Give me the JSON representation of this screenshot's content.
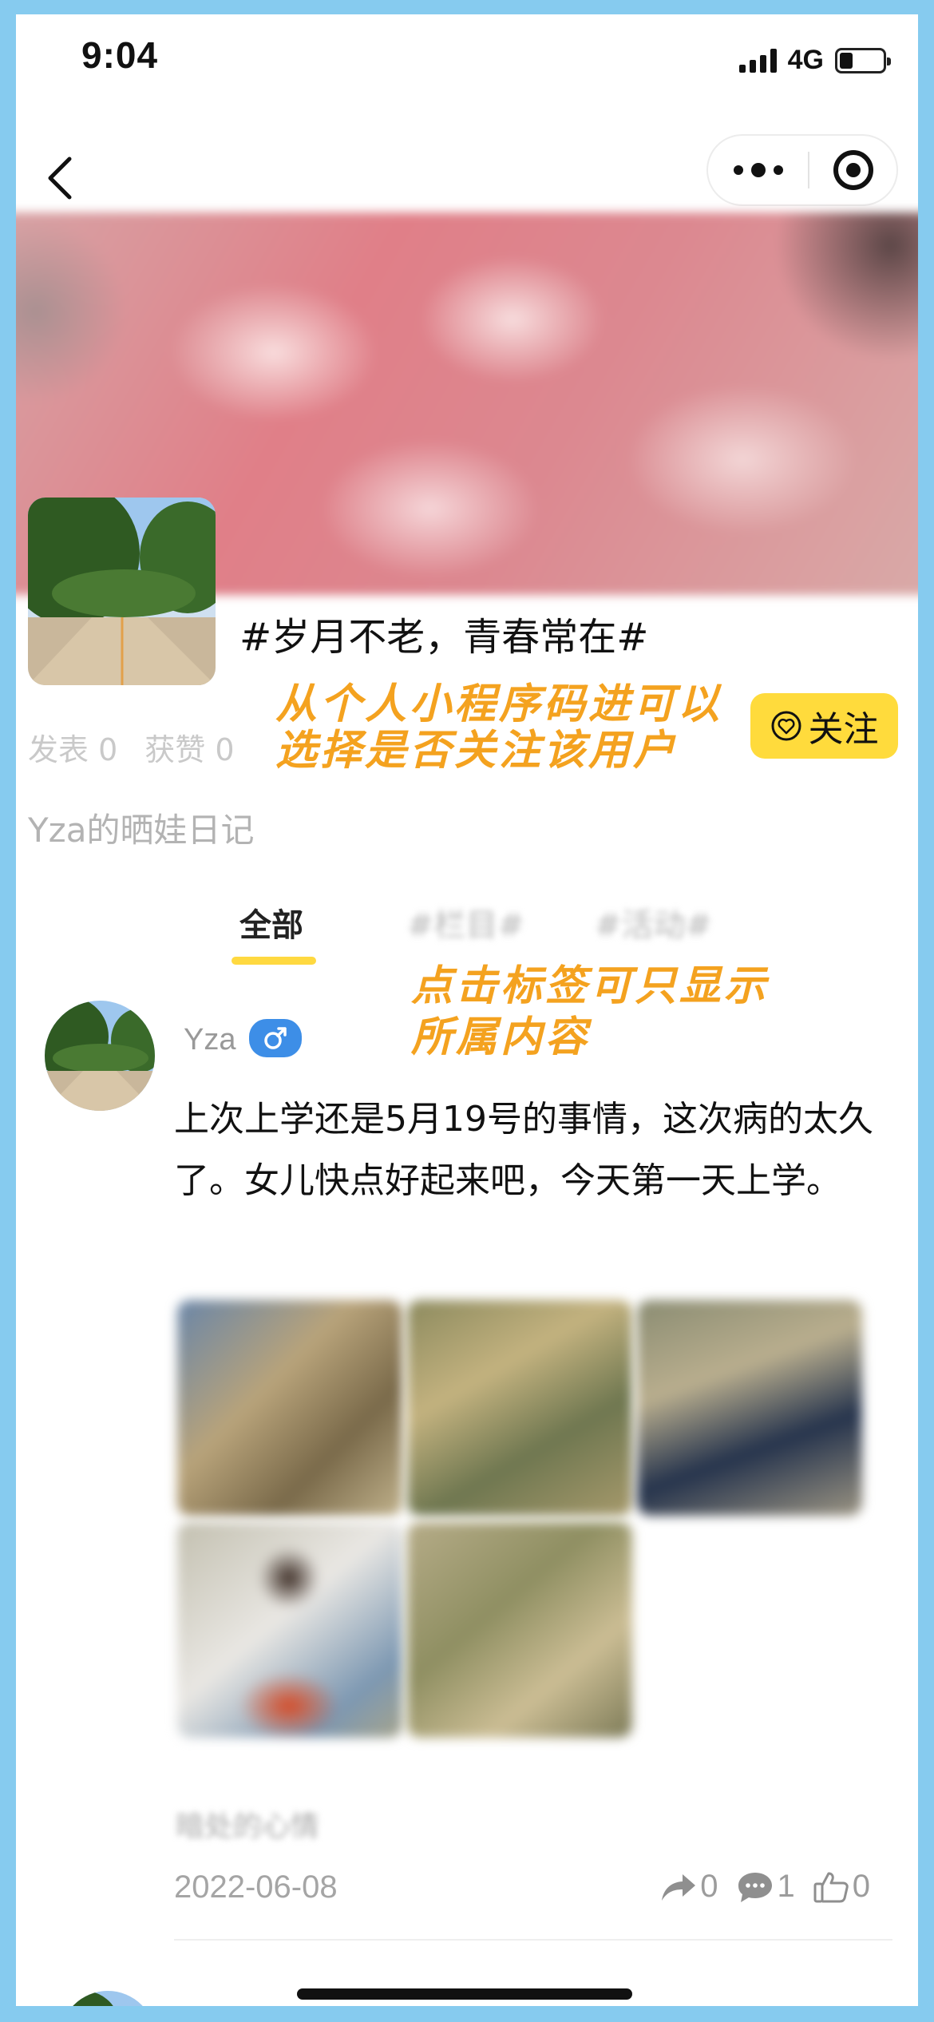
{
  "status_bar": {
    "time": "9:04",
    "network": "4G"
  },
  "profile": {
    "tag_title": "#岁月不老，青春常在#",
    "stats": {
      "posts_label": "发表 0",
      "likes_label": "获赞 0"
    },
    "diary_title": "Yza的晒娃日记",
    "follow_label": "关注"
  },
  "annotations": {
    "follow_note": "从个人小程序码进可以选择是否关注该用户",
    "tag_note": "点击标签可只显示所属内容"
  },
  "tabs": [
    {
      "label": "全部",
      "active": true
    },
    {
      "label": "#栏目#",
      "active": false
    },
    {
      "label": "#活动#",
      "active": false
    }
  ],
  "post": {
    "username": "Yza",
    "gender": "♂",
    "text": "上次上学还是5月19号的事情，这次病的太久了。女儿快点好起来吧，今天第一天上学。",
    "blurred_caption": "暗处的心情",
    "date": "2022-06-08",
    "share_count": "0",
    "comment_count": "1",
    "like_count": "0"
  },
  "colors": {
    "accent_yellow": "#ffdb3c",
    "annotation_orange": "#f4a21f",
    "gender_blue": "#3d8ee7",
    "frame_blue": "#86cbef"
  }
}
